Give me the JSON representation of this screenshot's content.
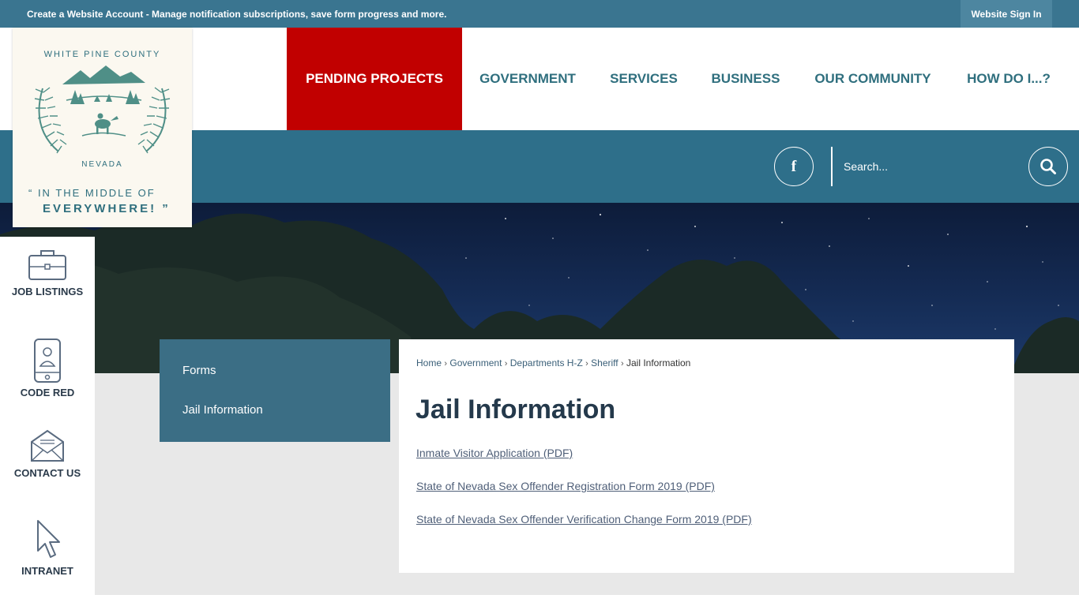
{
  "topbar": {
    "promo": "Create a Website Account - Manage notification subscriptions, save form progress and more.",
    "signin": "Website Sign In"
  },
  "logo": {
    "county": "WHITE PINE COUNTY",
    "state": "NEVADA",
    "tagline_line1": "“ IN THE MIDDLE OF",
    "tagline_line2": "EVERYWHERE! ”"
  },
  "nav": {
    "items": [
      {
        "label": "PENDING PROJECTS",
        "active": true
      },
      {
        "label": "GOVERNMENT"
      },
      {
        "label": "SERVICES"
      },
      {
        "label": "BUSINESS"
      },
      {
        "label": "OUR COMMUNITY"
      },
      {
        "label": "HOW DO I...?"
      }
    ]
  },
  "social": {
    "facebook_glyph": "f"
  },
  "search": {
    "placeholder": "Search..."
  },
  "quick_links": [
    {
      "label": "JOB LISTINGS",
      "icon": "briefcase-icon"
    },
    {
      "label": "CODE RED",
      "icon": "mobile-phone-icon"
    },
    {
      "label": "CONTACT US",
      "icon": "envelope-icon"
    },
    {
      "label": "INTRANET",
      "icon": "cursor-arrow-icon"
    }
  ],
  "subnav": {
    "items": [
      "Forms",
      "Jail Information"
    ]
  },
  "breadcrumb": {
    "items": [
      "Home",
      "Government",
      "Departments H-Z",
      "Sheriff"
    ],
    "current": "Jail Information",
    "separator": "›"
  },
  "main": {
    "title": "Jail Information",
    "links": [
      "Inmate Visitor Application (PDF)",
      "State of Nevada Sex Offender Registration Form 2019 (PDF)",
      "State of Nevada Sex Offender Verification Change Form 2019 (PDF)"
    ]
  },
  "colors": {
    "topbar": "#3a7590",
    "nav_text": "#2f6f7e",
    "active_nav": "#c10000",
    "band": "#2e6f8a",
    "subnav": "#3b6e85",
    "title": "#24394b"
  }
}
